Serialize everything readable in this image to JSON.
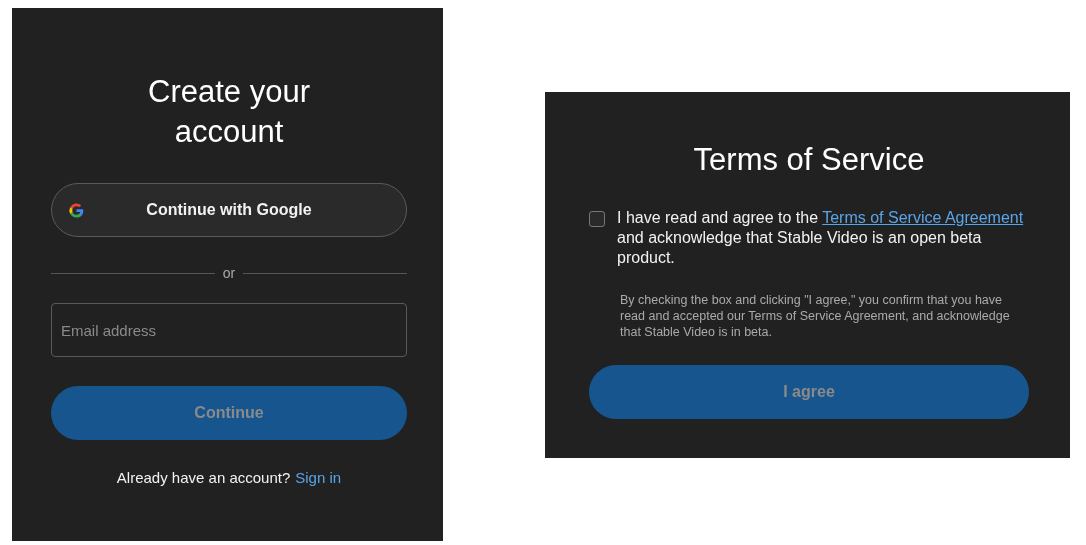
{
  "signup": {
    "title": "Create your account",
    "google_button": {
      "label": "Continue with Google"
    },
    "divider": "or",
    "email": {
      "placeholder": "Email address"
    },
    "continue_button": {
      "label": "Continue",
      "disabled": true
    },
    "footer": {
      "text": "Already have an account?",
      "link": "Sign in"
    }
  },
  "terms": {
    "title": "Terms of Service",
    "agree_checkbox": {
      "checked": false,
      "text_before": "I have read and agree to the",
      "link": "Terms of Service Agreement",
      "text_after": "and acknowledge that Stable Video is an open beta product."
    },
    "note": "By checking the box and clicking \"I agree,\" you confirm that you have read and accepted our Terms of Service Agreement, and acknowledge that Stable Video is in beta.",
    "agree_button": {
      "label": "I agree",
      "disabled": true
    }
  }
}
